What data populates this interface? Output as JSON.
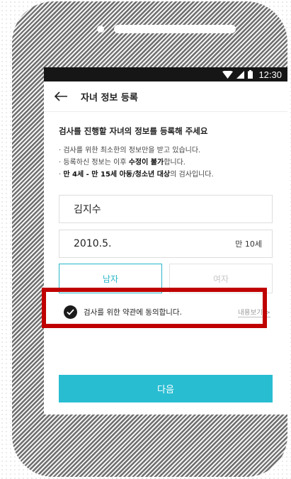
{
  "status_bar": {
    "time": "12:30"
  },
  "app_bar": {
    "title": "자녀 정보 등록"
  },
  "intro": {
    "heading": "검사를 진행할 자녀의 정보를 등록해 주세요",
    "note1": "검사를 위한 최소한의 정보만을 받고 있습니다.",
    "note2_pre": "등록하신 정보는 이후 ",
    "note2_bold": "수정이 불가",
    "note2_post": "합니다.",
    "note3_bold": "만 4세 - 만 15세 아동/청소년 대상",
    "note3_post": "의 검사입니다."
  },
  "form": {
    "name_value": "김지수",
    "birth_value": "2010.5.",
    "age_text": "만 10세",
    "gender_male": "남자",
    "gender_female": "여자",
    "selected_gender": "남자"
  },
  "consent": {
    "label": "검사를 위한 약관에 동의합니다.",
    "details_link": "내용보기 >",
    "checked": true
  },
  "next_button": {
    "label": "다음"
  },
  "colors": {
    "accent": "#29bdd2",
    "highlight_box": "#c00000",
    "status_bar": "#161616"
  },
  "icons": {
    "back": "arrow-left-icon",
    "wifi": "wifi-icon",
    "signal": "cell-signal-icon",
    "battery": "battery-icon",
    "check": "check-circle-icon"
  }
}
